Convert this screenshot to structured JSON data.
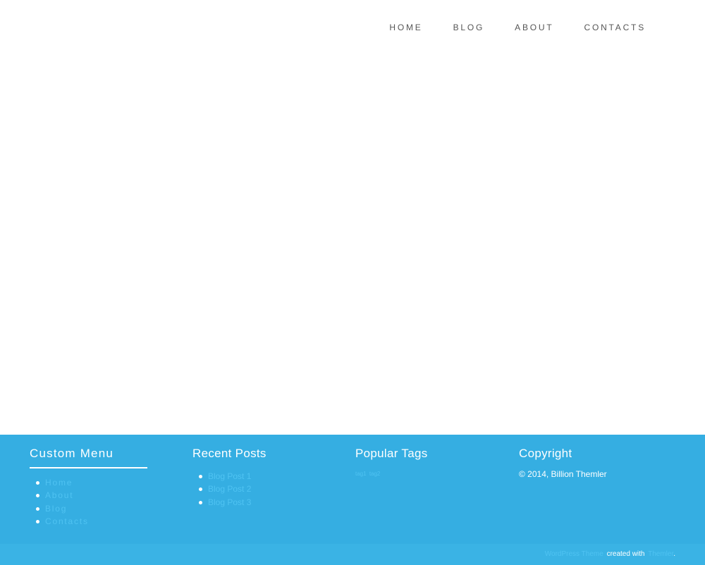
{
  "nav": {
    "items": [
      "Home",
      "Blog",
      "About",
      "Contacts"
    ]
  },
  "footer": {
    "custom_menu": {
      "title": "Custom Menu",
      "items": [
        "Home",
        "About",
        "Blog",
        "Contacts"
      ]
    },
    "recent_posts": {
      "title": "Recent Posts",
      "items": [
        "Blog Post 1",
        "Blog Post 2",
        "Blog Post 3"
      ]
    },
    "popular_tags": {
      "title": "Popular Tags",
      "tags": [
        "tag1",
        "tag2"
      ]
    },
    "copyright": {
      "title": "Copyright",
      "text": "© 2014, Billion Themler"
    }
  },
  "bottom_bar": {
    "theme_link": "WordPress Theme",
    "created_with": "created with",
    "tool_link": "Themler",
    "end": "."
  },
  "colors": {
    "footer_bg": "#35aee2",
    "link": "#4fc3f2",
    "nav_text": "#555555"
  }
}
